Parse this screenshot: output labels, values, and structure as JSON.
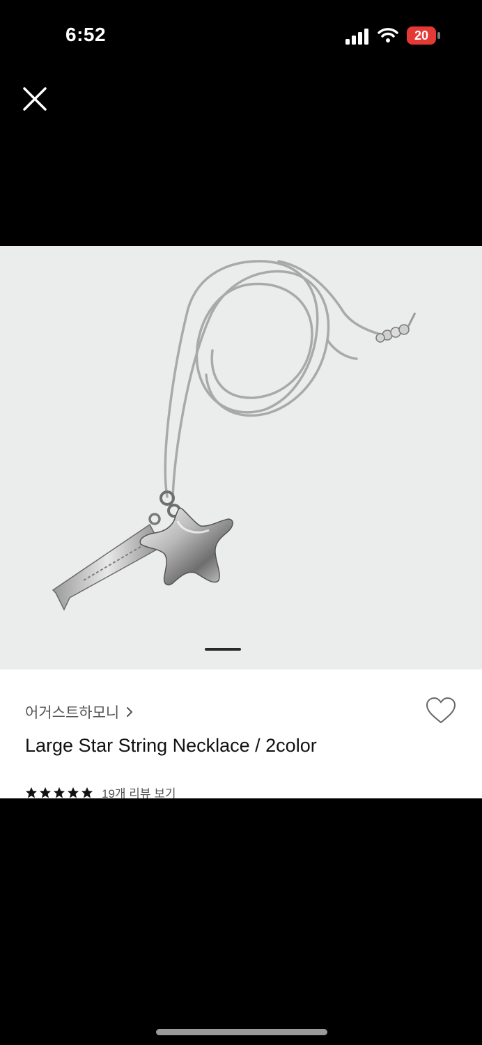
{
  "status_bar": {
    "time": "6:52",
    "battery_level": "20",
    "battery_color": "#e53935",
    "icons": [
      "signal-icon",
      "wifi-icon",
      "battery-charging-icon"
    ]
  },
  "viewer": {
    "close_icon": "close-icon",
    "image_count_indicator": "page-indicator-active"
  },
  "product": {
    "brand": "어거스트하모니",
    "title": "Large Star String Necklace / 2color",
    "rating_stars": 5,
    "review_label": "19개 리뷰 보기",
    "favorite_icon": "heart-outline-icon"
  },
  "colors": {
    "photo_background": "#ebecec",
    "panel_background": "#ffffff",
    "text_primary": "#111111",
    "text_secondary": "#555555"
  }
}
